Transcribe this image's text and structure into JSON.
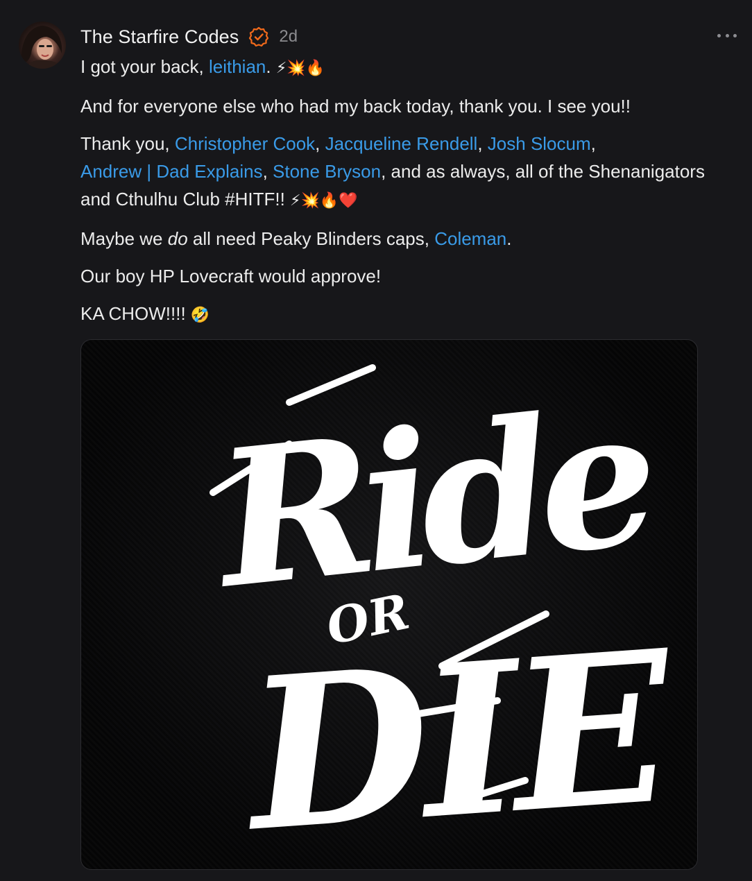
{
  "post": {
    "author": "The Starfire Codes",
    "timestamp": "2d",
    "verified_icon": "verified-badge-icon",
    "more_icon": "more-options-icon",
    "paragraphs": {
      "p1": {
        "before": "I got your back, ",
        "mention": "leithian",
        "after": ".",
        "emoji": "⚡💥🔥"
      },
      "p2": {
        "text": "And for everyone else who had my back today, thank you. I see you!!"
      },
      "p3": {
        "before": "Thank you, ",
        "m1": "Christopher Cook",
        "s1": ", ",
        "m2": "Jacqueline Rendell",
        "s2": ", ",
        "m3": "Josh Slocum",
        "s3": ",",
        "m4": "Andrew | Dad Explains",
        "s4": ", ",
        "m5": "Stone Bryson",
        "after": ", and as always, all of the Shenanigators and Cthulhu Club #HITF!! ",
        "emoji": "⚡💥🔥❤️"
      },
      "p4": {
        "before": "Maybe we ",
        "italic": "do",
        "middle": " all need Peaky Blinders caps, ",
        "mention": "Coleman",
        "after": "."
      },
      "p5": {
        "text": "Our boy HP Lovecraft would approve!"
      },
      "p6": {
        "text": "KA CHOW!!!! ",
        "emoji": "🤣"
      }
    },
    "image": {
      "line1": "Ride",
      "line2": "OR",
      "line3": "DIE"
    }
  },
  "colors": {
    "background": "#17171a",
    "link": "#3a9be8",
    "text": "#ececec",
    "muted": "#8b8b8f",
    "verified": "#f26a1b"
  }
}
